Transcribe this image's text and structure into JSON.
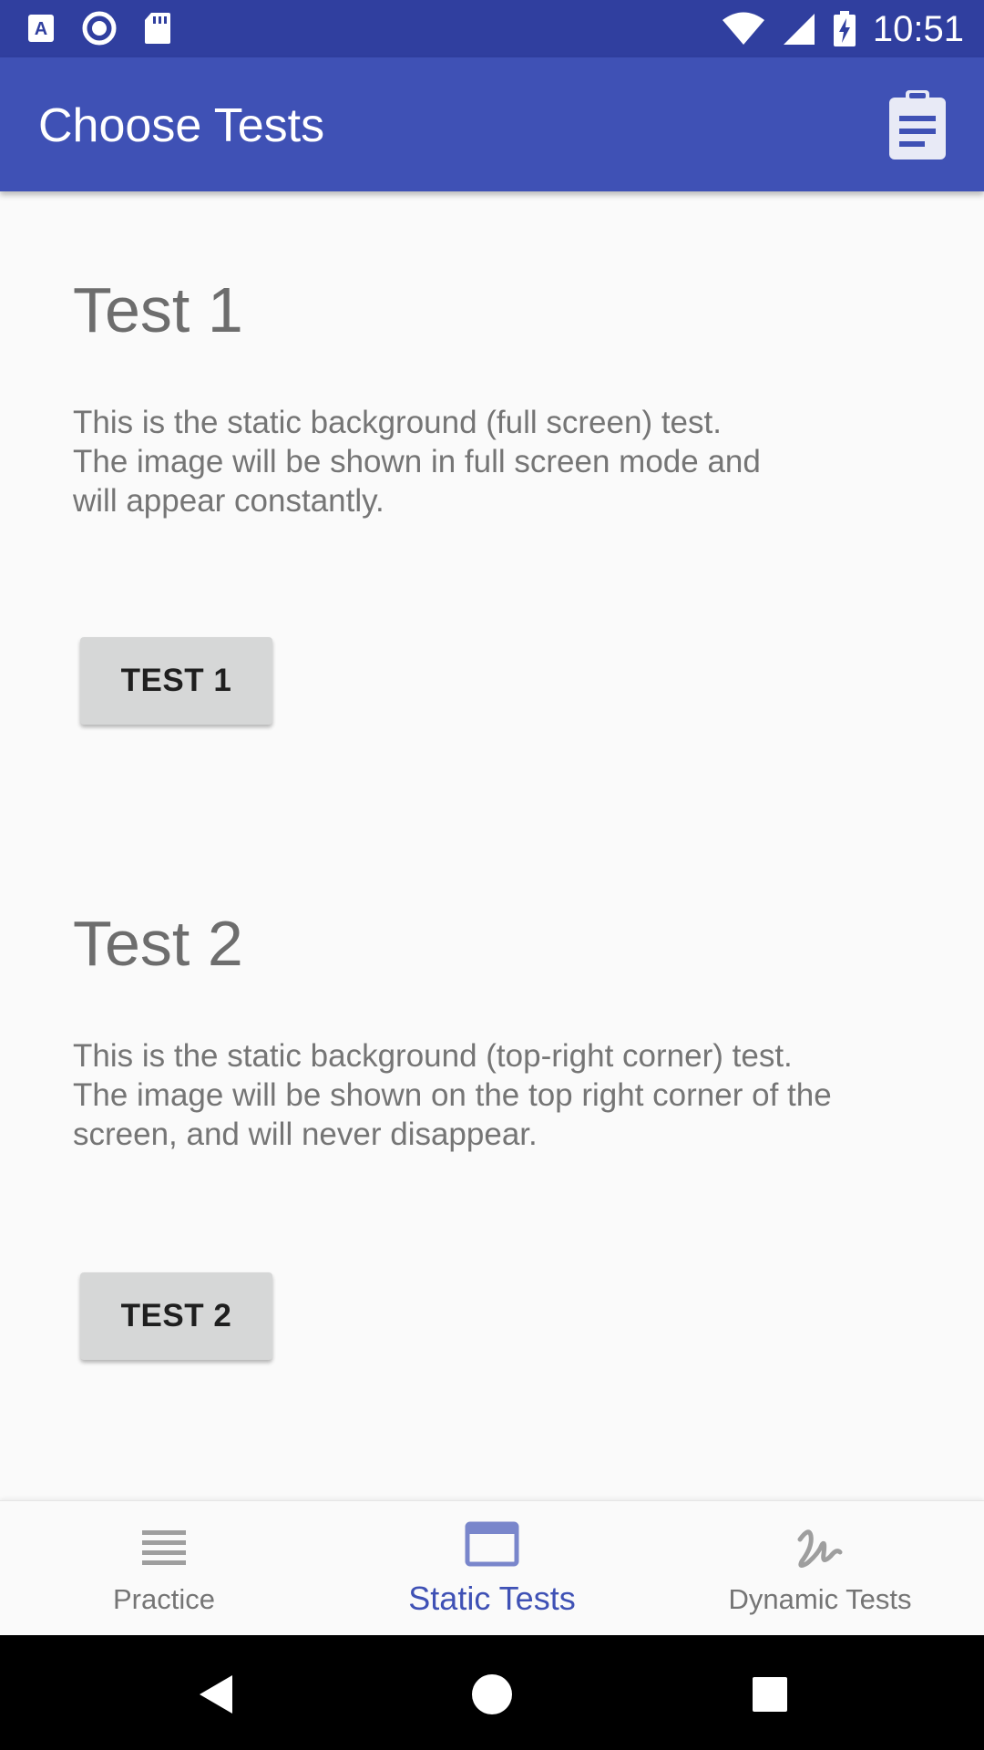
{
  "status_bar": {
    "time": "10:51",
    "left_icons": [
      "text-a-notification-icon",
      "circle-record-icon",
      "sd-card-icon"
    ],
    "right_icons": [
      "wifi-icon",
      "signal-icon",
      "battery-charging-icon"
    ]
  },
  "app_bar": {
    "title": "Choose Tests",
    "action_icon": "clipboard-icon"
  },
  "sections": [
    {
      "title": "Test 1",
      "description": "This is the static background (full screen) test.\nThe image will be shown in full screen mode and\nwill appear constantly.",
      "button_label": "TEST 1"
    },
    {
      "title": "Test 2",
      "description": "This is the static background (top-right corner) test.\nThe image will be shown on the top right corner of the\nscreen, and will never disappear.",
      "button_label": "TEST 2"
    }
  ],
  "bottom_nav": {
    "items": [
      {
        "label": "Practice",
        "icon": "list-lines-icon",
        "active": false
      },
      {
        "label": "Static Tests",
        "icon": "window-icon",
        "active": true
      },
      {
        "label": "Dynamic Tests",
        "icon": "squiggle-icon",
        "active": false
      }
    ]
  },
  "system_nav": {
    "buttons": [
      "back-icon",
      "home-icon",
      "recents-icon"
    ]
  },
  "colors": {
    "status_bar": "#303f9f",
    "app_bar": "#3f51b5",
    "accent": "#3f51b5",
    "background": "#fafafa",
    "button": "#d6d7d7"
  }
}
